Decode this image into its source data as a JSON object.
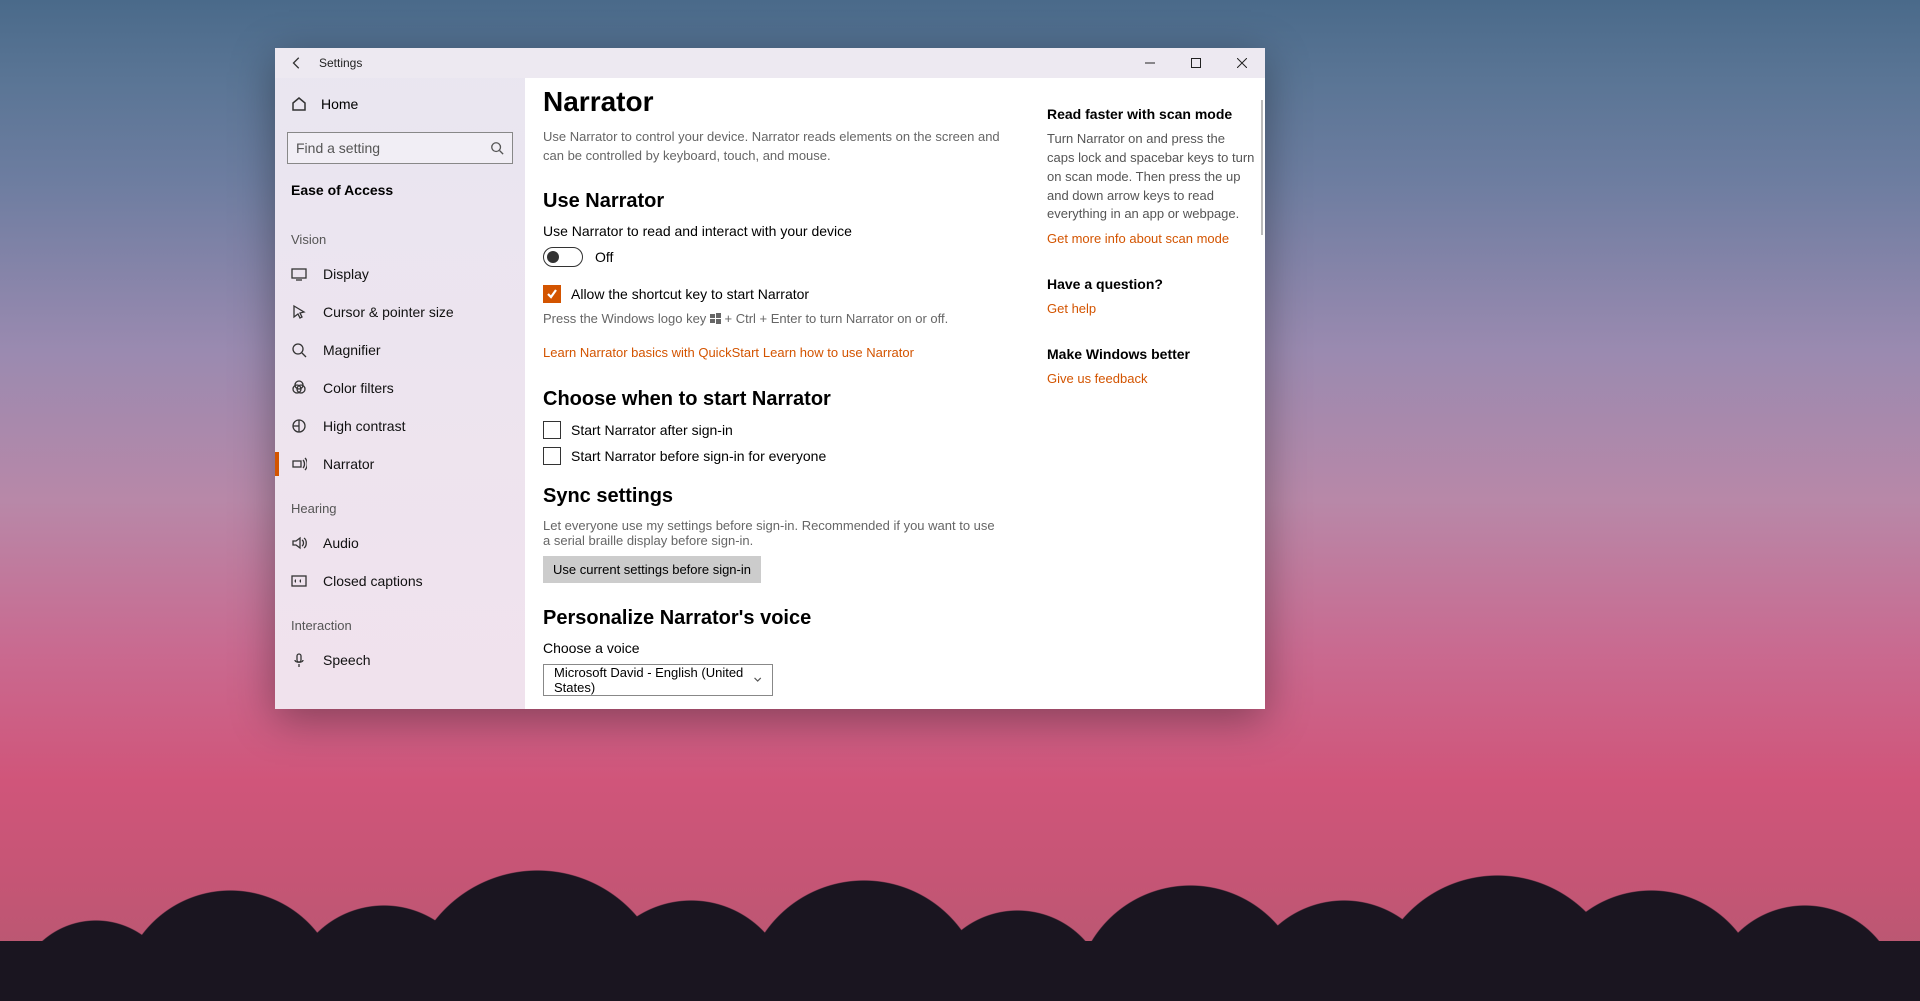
{
  "app_title": "Settings",
  "sidebar": {
    "home": "Home",
    "search_placeholder": "Find a setting",
    "category": "Ease of Access",
    "groups": [
      {
        "label": "Vision",
        "items": [
          {
            "label": "Display",
            "icon": "display"
          },
          {
            "label": "Cursor & pointer size",
            "icon": "cursor"
          },
          {
            "label": "Magnifier",
            "icon": "magnifier"
          },
          {
            "label": "Color filters",
            "icon": "color-filters"
          },
          {
            "label": "High contrast",
            "icon": "high-contrast"
          },
          {
            "label": "Narrator",
            "icon": "narrator",
            "active": true
          }
        ]
      },
      {
        "label": "Hearing",
        "items": [
          {
            "label": "Audio",
            "icon": "audio"
          },
          {
            "label": "Closed captions",
            "icon": "cc"
          }
        ]
      },
      {
        "label": "Interaction",
        "items": [
          {
            "label": "Speech",
            "icon": "speech"
          }
        ]
      }
    ]
  },
  "main": {
    "title": "Narrator",
    "description": "Use Narrator to control your device. Narrator reads elements on the screen and can be controlled by keyboard, touch, and mouse.",
    "use_narrator": {
      "heading": "Use Narrator",
      "label": "Use Narrator to read and interact with your device",
      "toggle_state": "Off",
      "shortcut_checkbox": "Allow the shortcut key to start Narrator",
      "shortcut_checked": true,
      "shortcut_hint_pre": "Press the Windows logo key ",
      "shortcut_hint_post": " + Ctrl + Enter to turn Narrator on or off.",
      "link_quickstart": "Learn Narrator basics with QuickStart",
      "link_learn": "Learn how to use Narrator"
    },
    "choose_when": {
      "heading": "Choose when to start Narrator",
      "after_signin": "Start Narrator after sign-in",
      "before_signin": "Start Narrator before sign-in for everyone"
    },
    "sync": {
      "heading": "Sync settings",
      "desc": "Let everyone use my settings before sign-in. Recommended if you want to use a serial braille display before sign-in.",
      "button": "Use current settings before sign-in"
    },
    "voice": {
      "heading": "Personalize Narrator's voice",
      "label": "Choose a voice",
      "selected": "Microsoft David - English (United States)"
    }
  },
  "aside": {
    "scan": {
      "heading": "Read faster with scan mode",
      "body": "Turn Narrator on and press the caps lock and spacebar keys to turn on scan mode. Then press the up and down arrow keys to read everything in an app or webpage.",
      "link": "Get more info about scan mode"
    },
    "question": {
      "heading": "Have a question?",
      "link": "Get help"
    },
    "feedback": {
      "heading": "Make Windows better",
      "link": "Give us feedback"
    }
  }
}
